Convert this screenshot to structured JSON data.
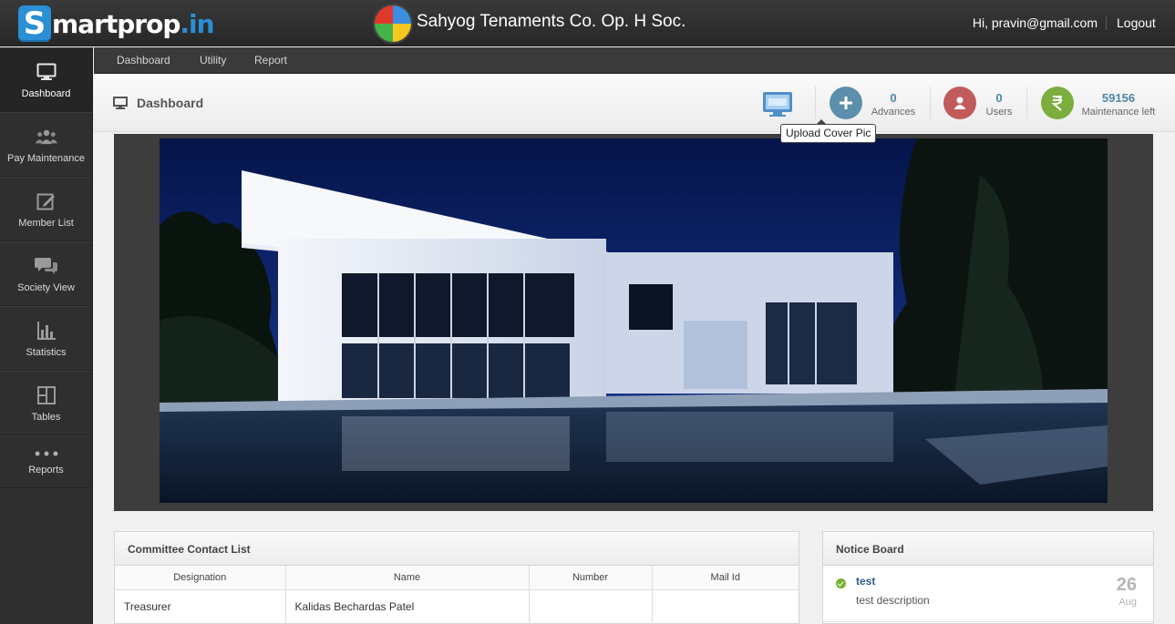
{
  "brand": {
    "logo_letter": "S",
    "logo_text": "martprop",
    "logo_domain": ".in"
  },
  "society": {
    "name": "Sahyog Tenaments Co. Op. H Soc."
  },
  "user": {
    "greeting": "Hi, pravin@gmail.com",
    "logout_label": "Logout"
  },
  "sidebar": {
    "items": [
      {
        "label": "Dashboard",
        "icon": "monitor-icon",
        "active": true
      },
      {
        "label": "Pay Maintenance",
        "icon": "users-group-icon"
      },
      {
        "label": "Member List",
        "icon": "edit-icon"
      },
      {
        "label": "Society View",
        "icon": "chat-bubbles-icon"
      },
      {
        "label": "Statistics",
        "icon": "bar-chart-icon"
      },
      {
        "label": "Tables",
        "icon": "table-grid-icon"
      },
      {
        "label": "Reports",
        "icon": "dots-icon"
      }
    ]
  },
  "subnav": {
    "items": [
      "Dashboard",
      "Utility",
      "Report"
    ]
  },
  "header": {
    "title": "Dashboard"
  },
  "stats": [
    {
      "value": "0",
      "label": "Advances",
      "icon": "plus-icon",
      "color": "#5b8fab"
    },
    {
      "value": "0",
      "label": "Users",
      "icon": "user-icon",
      "color": "#c15b5b"
    },
    {
      "value": "59156",
      "label": "Maintenance left",
      "icon": "rupee-icon",
      "color": "#7cad3d"
    }
  ],
  "cover": {
    "upload_tooltip": "Upload Cover Pic"
  },
  "committee": {
    "title": "Committee Contact List",
    "columns": [
      "Designation",
      "Name",
      "Number",
      "Mail Id"
    ],
    "rows": [
      [
        "Treasurer",
        "Kalidas Bechardas Patel",
        "",
        ""
      ]
    ]
  },
  "notice_board": {
    "title": "Notice Board",
    "items": [
      {
        "title": "test",
        "description": "test description",
        "day": "26",
        "month": "Aug"
      }
    ]
  },
  "colors": {
    "accent_blue": "#2a8fd4",
    "topbar": "#2f2f2f"
  }
}
